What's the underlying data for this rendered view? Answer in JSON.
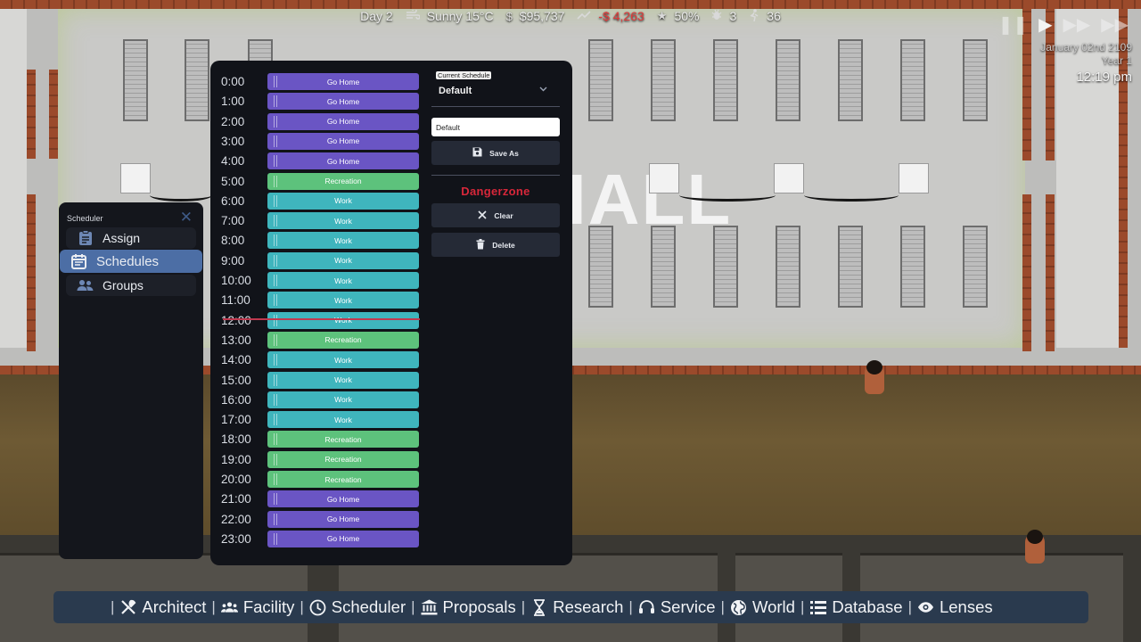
{
  "hud": {
    "day": "Day 2",
    "weather": "Sunny 15°C",
    "money": "$95,737",
    "income": "-$ 4,263",
    "rating": "50%",
    "count_a": "3",
    "count_b": "36",
    "date": "January 02nd 2109",
    "year": "Year 1",
    "time": "12:19 pm",
    "accent_negative": "#e23b3b"
  },
  "left_panel": {
    "title": "Scheduler",
    "items": [
      {
        "label": "Assign",
        "icon": "clipboard-icon"
      },
      {
        "label": "Schedules",
        "icon": "calendar-icon",
        "active": true
      },
      {
        "label": "Groups",
        "icon": "people-icon"
      }
    ]
  },
  "schedule": {
    "colors": {
      "Go Home": "#6a55c4",
      "Recreation": "#5dc27c",
      "Work": "#3fb5bd"
    },
    "rows": [
      {
        "hour": "0:00",
        "activity": "Go Home"
      },
      {
        "hour": "1:00",
        "activity": "Go Home"
      },
      {
        "hour": "2:00",
        "activity": "Go Home"
      },
      {
        "hour": "3:00",
        "activity": "Go Home"
      },
      {
        "hour": "4:00",
        "activity": "Go Home"
      },
      {
        "hour": "5:00",
        "activity": "Recreation"
      },
      {
        "hour": "6:00",
        "activity": "Work"
      },
      {
        "hour": "7:00",
        "activity": "Work"
      },
      {
        "hour": "8:00",
        "activity": "Work"
      },
      {
        "hour": "9:00",
        "activity": "Work"
      },
      {
        "hour": "10:00",
        "activity": "Work"
      },
      {
        "hour": "11:00",
        "activity": "Work"
      },
      {
        "hour": "12:00",
        "activity": "Work"
      },
      {
        "hour": "13:00",
        "activity": "Recreation"
      },
      {
        "hour": "14:00",
        "activity": "Work"
      },
      {
        "hour": "15:00",
        "activity": "Work"
      },
      {
        "hour": "16:00",
        "activity": "Work"
      },
      {
        "hour": "17:00",
        "activity": "Work"
      },
      {
        "hour": "18:00",
        "activity": "Recreation"
      },
      {
        "hour": "19:00",
        "activity": "Recreation"
      },
      {
        "hour": "20:00",
        "activity": "Recreation"
      },
      {
        "hour": "21:00",
        "activity": "Go Home"
      },
      {
        "hour": "22:00",
        "activity": "Go Home"
      },
      {
        "hour": "23:00",
        "activity": "Go Home"
      }
    ],
    "current_schedule_label": "Current Schedule",
    "current_schedule_value": "Default",
    "name_input_value": "Default",
    "save_as_label": "Save As",
    "dangerzone_label": "Dangerzone",
    "clear_label": "Clear",
    "delete_label": "Delete",
    "danger_color": "#d8273a"
  },
  "world": {
    "room_label": "HALL"
  },
  "toolbar": {
    "items": [
      {
        "label": "Architect",
        "icon": "tools-icon"
      },
      {
        "label": "Facility",
        "icon": "staff-icon"
      },
      {
        "label": "Scheduler",
        "icon": "clock-icon"
      },
      {
        "label": "Proposals",
        "icon": "bank-icon"
      },
      {
        "label": "Research",
        "icon": "hourglass-icon"
      },
      {
        "label": "Service",
        "icon": "headset-icon"
      },
      {
        "label": "World",
        "icon": "globe-icon"
      },
      {
        "label": "Database",
        "icon": "list-icon"
      },
      {
        "label": "Lenses",
        "icon": "eye-icon"
      }
    ]
  }
}
